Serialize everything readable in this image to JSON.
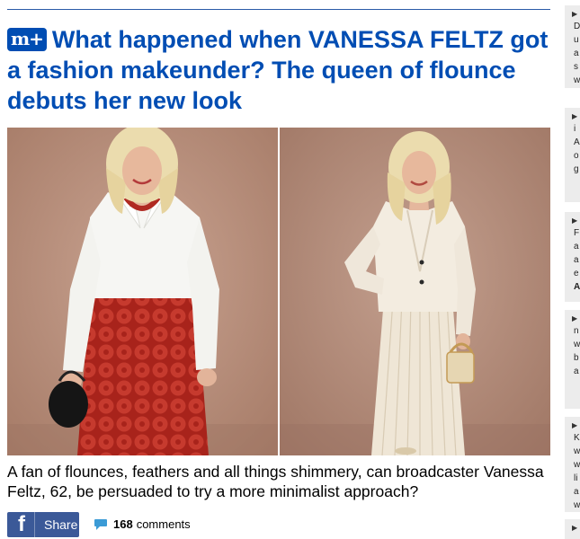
{
  "article": {
    "badge": "m+",
    "headline": "What happened when VANESSA FELTZ got a fashion makeunder? The queen of flounce debuts her new look",
    "caption": "A fan of flounces, feathers and all things shimmery, can broadcaster Vanessa Feltz, 62, be persuaded to try a more minimalist approach?",
    "images": [
      {
        "name": "vanessa-white-shirt-red-skirt-photo"
      },
      {
        "name": "vanessa-cream-suit-photo"
      }
    ]
  },
  "social": {
    "share_label": "Share",
    "facebook_glyph": "f",
    "comment_count": "168",
    "comments_label": "comments",
    "icons": {
      "share": "facebook-icon",
      "comments": "speech-bubble-icon"
    }
  },
  "colors": {
    "headline": "#004db3",
    "facebook": "#3b5998",
    "comment_bubble": "#3b9bd6",
    "sidebar_bg": "#ececec"
  },
  "sidebar": {
    "items": [
      {
        "lines": [
          "D",
          "u",
          "a",
          "s",
          "w"
        ]
      },
      {
        "lines": [
          "i",
          "A",
          "o",
          "g"
        ]
      },
      {
        "lines": [
          "F",
          "a",
          "a",
          "e",
          "A"
        ]
      },
      {
        "lines": [
          "n",
          "w",
          "b",
          "a"
        ]
      },
      {
        "lines": [
          "K",
          "w",
          "w",
          "li",
          "a",
          "w"
        ]
      },
      {
        "lines": []
      }
    ]
  }
}
